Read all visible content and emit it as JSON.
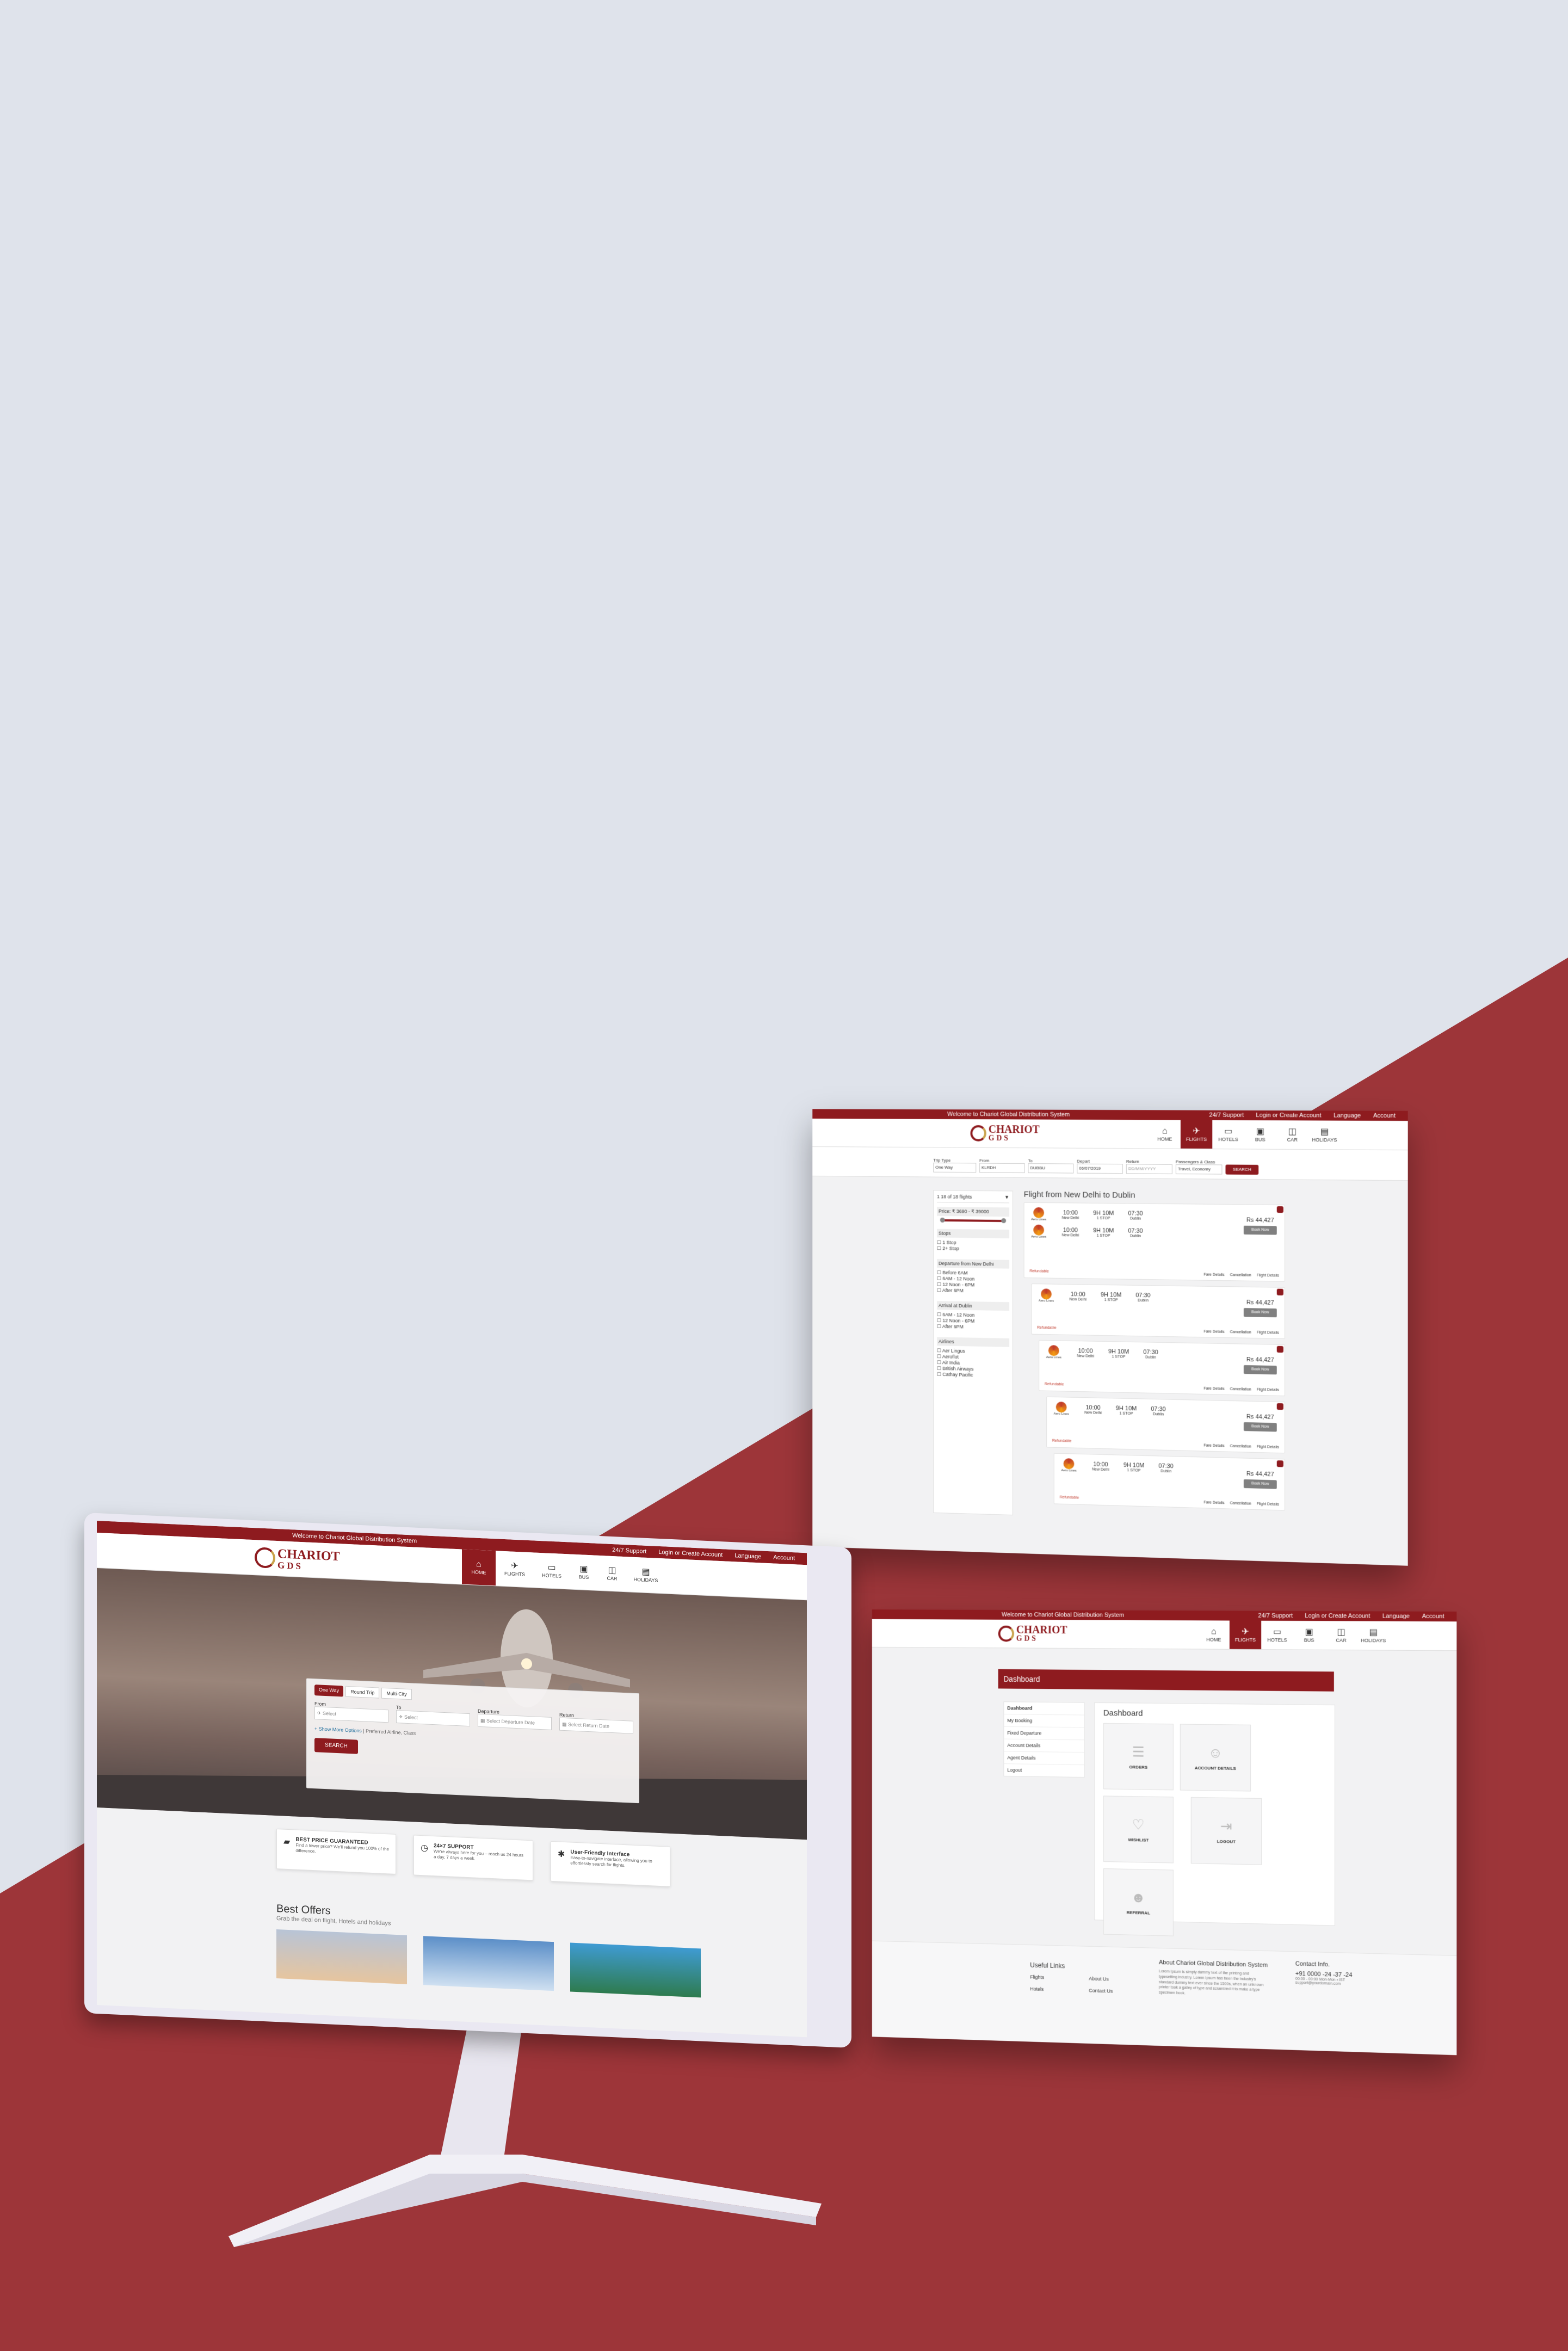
{
  "colors": {
    "brand": "#8e1b1f",
    "background": "#dfe3eb",
    "accent_red": "#9d3539",
    "monitor": "#e9e6f2"
  },
  "header": {
    "welcome": "Welcome to Chariot Global Distribution System",
    "support": "24/7 Support",
    "login": "Login or Create Account",
    "language": "Language",
    "account": "Account"
  },
  "logo": {
    "line1": "CHARIOT",
    "line2": "GDS"
  },
  "nav": [
    {
      "label": "HOME",
      "icon": "home-icon",
      "glyph": "⌂"
    },
    {
      "label": "FLIGHTS",
      "icon": "plane-icon",
      "glyph": "✈"
    },
    {
      "label": "HOTELS",
      "icon": "bed-icon",
      "glyph": "▭"
    },
    {
      "label": "BUS",
      "icon": "bus-icon",
      "glyph": "▣"
    },
    {
      "label": "CAR",
      "icon": "car-icon",
      "glyph": "◫"
    },
    {
      "label": "HOLIDAYS",
      "icon": "suitcase-icon",
      "glyph": "▤"
    }
  ],
  "home": {
    "tabs": [
      "One Way",
      "Round Trip",
      "Multi-City"
    ],
    "from_label": "From",
    "to_label": "To",
    "departure_label": "Departure",
    "return_label": "Return",
    "from_placeholder": "Select",
    "to_placeholder": "Select",
    "departure_placeholder": "Select Departure Date",
    "return_placeholder": "Select Return Date",
    "more_options": "+ Show More Options",
    "more_options_hint": "| Preferred Airline, Class",
    "search": "SEARCH",
    "features": [
      {
        "title": "BEST PRICE GUARANTEED",
        "text": "Find a lower price? We'll refund you 100% of the difference.",
        "icon": "wallet-icon",
        "glyph": "▰"
      },
      {
        "title": "24×7 SUPPORT",
        "text": "We're always here for you – reach us 24 hours a day, 7 days a week.",
        "icon": "clock-icon",
        "glyph": "◷"
      },
      {
        "title": "User-Friendly Interface",
        "text": "Easy-to-navigate interface, allowing you to effortlessly search for flights.",
        "icon": "gear-icon",
        "glyph": "✱"
      }
    ],
    "offers_title": "Best Offers",
    "offers_subtitle": "Grab the deal on flight, Hotels and holidays"
  },
  "search_results": {
    "search_bar": {
      "trip_label": "Trip Type",
      "trip_value": "One Way",
      "from_label": "From",
      "from_value": "KLRDH",
      "to_label": "To",
      "to_value": "DUBBU",
      "depart_label": "Depart",
      "depart_value": "06/07/2019",
      "return_label": "Return",
      "return_value": "DD/MM/YYYY",
      "class_label": "Passengers & Class",
      "class_value": "Travel, Economy",
      "search": "SEARCH"
    },
    "filters": {
      "count": "1 18 of 18 flights",
      "price": "Price: ₹ 3690 - ₹ 39000",
      "stops_title": "Stops",
      "stops": [
        "1 Stop",
        "2+ Stop"
      ],
      "departure_title": "Departure from New Delhi",
      "departure": [
        "Before 6AM",
        "6AM - 12 Noon",
        "12 Noon - 6PM",
        "After 6PM"
      ],
      "arrival_title": "Arrival at Dublin",
      "arrival": [
        "6AM - 12 Noon",
        "12 Noon - 6PM",
        "After 6PM"
      ],
      "airlines_title": "Airlines",
      "airlines": [
        "Aer Lingus",
        "Aeroflot",
        "Air India",
        "British Airways",
        "Cathay Pacific"
      ]
    },
    "title": "Flight from New Delhi to Dublin",
    "flights": [
      {
        "dep": "10:00",
        "dep_city": "New Delhi",
        "dur": "9H 10M",
        "stops": "1 STOP",
        "arr": "07:30",
        "arr_city": "Dublin",
        "price": "Rs 44,427",
        "book": "Book Now",
        "airline": "Aero Lines"
      },
      {
        "dep": "10:00",
        "dep_city": "New Delhi",
        "dur": "9H 10M",
        "stops": "1 STOP",
        "arr": "07:30",
        "arr_city": "Dublin",
        "price": "Rs 44,427",
        "book": "Book Now",
        "airline": "Aero Lines"
      },
      {
        "dep": "10:00",
        "dep_city": "New Delhi",
        "dur": "9H 10M",
        "stops": "1 STOP",
        "arr": "07:30",
        "arr_city": "Dublin",
        "price": "Rs 44,427",
        "book": "Book Now",
        "airline": "Aero Lines"
      },
      {
        "dep": "10:00",
        "dep_city": "New Delhi",
        "dur": "9H 10M",
        "stops": "1 STOP",
        "arr": "07:30",
        "arr_city": "Dublin",
        "price": "Rs 44,427",
        "book": "Book Now",
        "airline": "Aero Lines"
      },
      {
        "dep": "10:00",
        "dep_city": "New Delhi",
        "dur": "9H 10M",
        "stops": "1 STOP",
        "arr": "07:30",
        "arr_city": "Dublin",
        "price": "Rs 44,427",
        "book": "Book Now",
        "airline": "Aero Lines"
      }
    ],
    "refundable": "Refundable",
    "fare_details": "Fare Details",
    "cancellation": "Cancellation",
    "flight_details": "Flight Details"
  },
  "dashboard": {
    "banner": "Dashboard",
    "side": [
      "Dashboard",
      "My Booking",
      "Fixed Departure",
      "Account Details",
      "Agent Details",
      "Logout"
    ],
    "title": "Dashboard",
    "tiles": [
      {
        "label": "ORDERS",
        "icon": "orders-icon",
        "glyph": "☰"
      },
      {
        "label": "ACCOUNT DETAILS",
        "icon": "user-icon",
        "glyph": "☺"
      },
      {
        "label": "WISHLIST",
        "icon": "heart-icon",
        "glyph": "♡"
      },
      {
        "label": "LOGOUT",
        "icon": "logout-icon",
        "glyph": "⇥"
      },
      {
        "label": "REFERRAL",
        "icon": "group-icon",
        "glyph": "☻"
      }
    ],
    "footer": {
      "links_title": "Useful Links",
      "links": [
        "Flights",
        "Hotels",
        "About Us",
        "Contact Us"
      ],
      "about_title": "About Chariot Global Distribution System",
      "about_text": "Lorem Ipsum is simply dummy text of the printing and typesetting industry. Lorem Ipsum has been the industry's standard dummy text ever since the 1500s, when an unknown printer took a galley of type and scrambled it to make a type specimen book.",
      "contact_title": "Contact Info.",
      "phone": "+91 0000 -24 -37 -24",
      "hours": "00:00 - 00:00 Mon-Mon • IST",
      "email": "support@yourdomain.com"
    }
  }
}
